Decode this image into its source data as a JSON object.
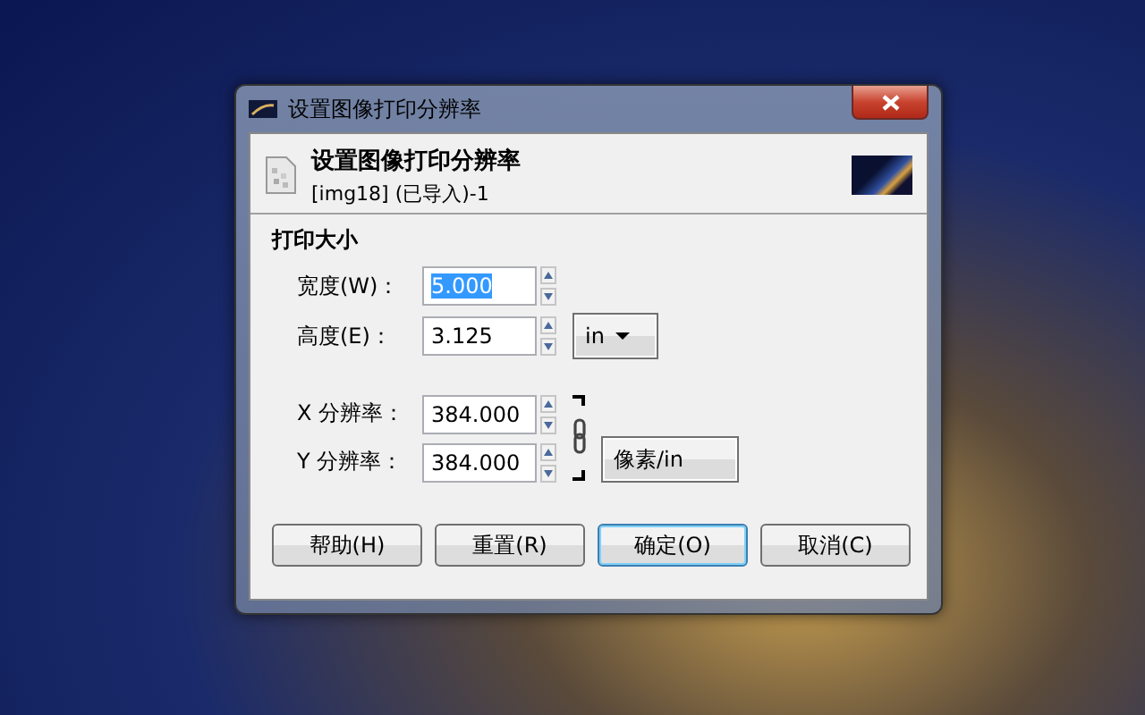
{
  "window": {
    "title": "设置图像打印分辨率"
  },
  "header": {
    "title": "设置图像打印分辨率",
    "subtitle": "[img18] (已导入)-1"
  },
  "section": {
    "title": "打印大小"
  },
  "fields": [
    {
      "label": "宽度(W)：",
      "value": "5.000",
      "selected": true
    },
    {
      "label": "高度(E)：",
      "value": "3.125",
      "selected": false
    },
    {
      "label": "X 分辨率：",
      "value": "384.000",
      "selected": false
    },
    {
      "label": "Y 分辨率：",
      "value": "384.000",
      "selected": false
    }
  ],
  "size_unit": "in",
  "resolution_unit": "像素/in",
  "chain_linked": true,
  "buttons": [
    {
      "label": "帮助(H)",
      "default": false
    },
    {
      "label": "重置(R)",
      "default": false
    },
    {
      "label": "确定(O)",
      "default": true
    },
    {
      "label": "取消(C)",
      "default": false
    }
  ]
}
